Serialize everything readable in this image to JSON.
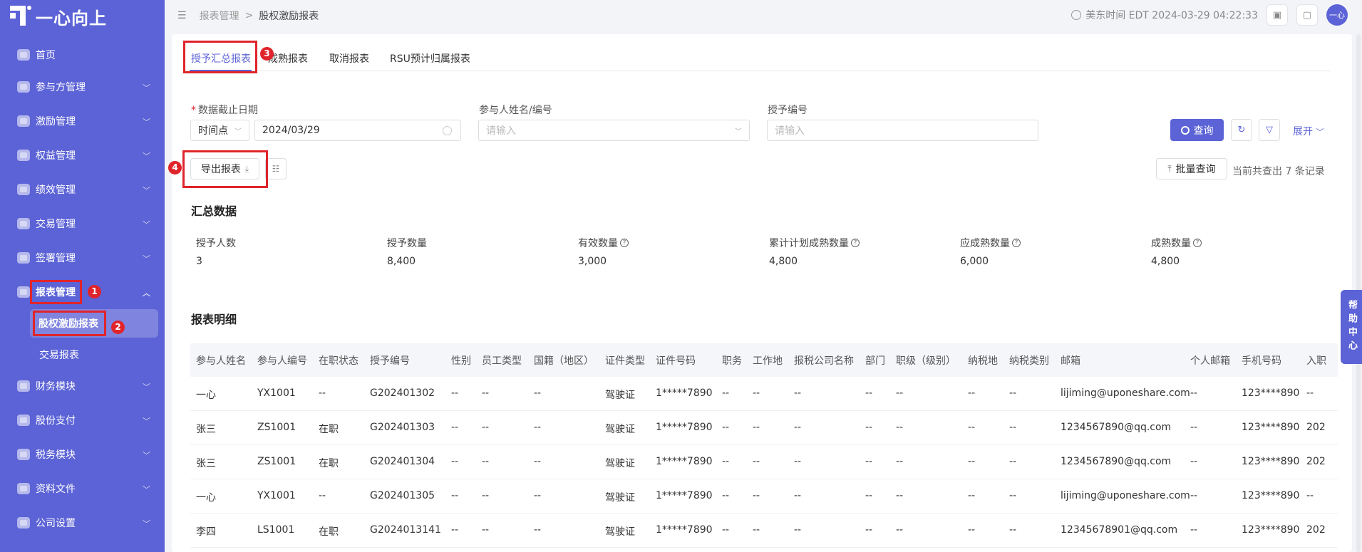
{
  "brand": {
    "logo_text": "一心向上"
  },
  "sidebar": {
    "items": [
      {
        "label": "首页"
      },
      {
        "label": "参与方管理"
      },
      {
        "label": "激励管理"
      },
      {
        "label": "权益管理"
      },
      {
        "label": "绩效管理"
      },
      {
        "label": "交易管理"
      },
      {
        "label": "签署管理"
      },
      {
        "label": "报表管理"
      },
      {
        "label": "财务模块"
      },
      {
        "label": "股份支付"
      },
      {
        "label": "税务模块"
      },
      {
        "label": "资料文件"
      },
      {
        "label": "公司设置"
      }
    ],
    "sub_items": [
      {
        "label": "股权激励报表"
      },
      {
        "label": "交易报表"
      }
    ]
  },
  "annotations": [
    "1",
    "2",
    "3",
    "4"
  ],
  "header": {
    "breadcrumb": [
      "报表管理",
      "股权激励报表"
    ],
    "breadcrumb_sep": ">",
    "time": "美东时间 EDT 2024-03-29 04:22:33",
    "avatar": "一心"
  },
  "tabs": [
    "授予汇总报表",
    "成熟报表",
    "取消报表",
    "RSU预计归属报表"
  ],
  "filters": {
    "date_label": "数据截止日期",
    "date_type": "时间点",
    "date_value": "2024/03/29",
    "participant_label": "参与人姓名/编号",
    "participant_placeholder": "请输入",
    "grant_label": "授予编号",
    "grant_placeholder": "请输入",
    "query_label": "查询",
    "expand_label": "展开"
  },
  "toolbar": {
    "export_label": "导出报表",
    "batch_query_label": "批量查询",
    "records_text": "当前共查出 7 条记录"
  },
  "summary": {
    "title": "汇总数据",
    "items": [
      {
        "label": "授予人数",
        "value": "3"
      },
      {
        "label": "授予数量",
        "value": "8,400"
      },
      {
        "label": "有效数量",
        "value": "3,000"
      },
      {
        "label": "累计计划成熟数量",
        "value": "4,800"
      },
      {
        "label": "应成熟数量",
        "value": "6,000"
      },
      {
        "label": "成熟数量",
        "value": "4,800"
      }
    ]
  },
  "detail": {
    "title": "报表明细",
    "columns": [
      "参与人姓名",
      "参与人编号",
      "在职状态",
      "授予编号",
      "性别",
      "员工类型",
      "国籍（地区）",
      "证件类型",
      "证件号码",
      "职务",
      "工作地",
      "报税公司名称",
      "部门",
      "职级（级别）",
      "纳税地",
      "纳税类别",
      "邮箱",
      "个人邮箱",
      "手机号码",
      "入职"
    ],
    "rows": [
      [
        "一心",
        "YX1001",
        "--",
        "G202401302",
        "--",
        "--",
        "--",
        "驾驶证",
        "1*****7890",
        "--",
        "--",
        "--",
        "--",
        "--",
        "--",
        "--",
        "lijiming@uponeshare.com",
        "--",
        "123****890",
        "--"
      ],
      [
        "张三",
        "ZS1001",
        "在职",
        "G202401303",
        "--",
        "--",
        "--",
        "驾驶证",
        "1*****7890",
        "--",
        "--",
        "--",
        "--",
        "--",
        "--",
        "--",
        "1234567890@qq.com",
        "--",
        "123****890",
        "202"
      ],
      [
        "张三",
        "ZS1001",
        "在职",
        "G202401304",
        "--",
        "--",
        "--",
        "驾驶证",
        "1*****7890",
        "--",
        "--",
        "--",
        "--",
        "--",
        "--",
        "--",
        "1234567890@qq.com",
        "--",
        "123****890",
        "202"
      ],
      [
        "一心",
        "YX1001",
        "--",
        "G202401305",
        "--",
        "--",
        "--",
        "驾驶证",
        "1*****7890",
        "--",
        "--",
        "--",
        "--",
        "--",
        "--",
        "--",
        "lijiming@uponeshare.com",
        "--",
        "123****890",
        "--"
      ],
      [
        "李四",
        "LS1001",
        "在职",
        "G2024013141",
        "--",
        "--",
        "--",
        "驾驶证",
        "1*****7890",
        "--",
        "--",
        "--",
        "--",
        "--",
        "--",
        "--",
        "12345678901@qq.com",
        "--",
        "123****890",
        "202"
      ]
    ]
  },
  "help": {
    "label": "帮助中心"
  }
}
